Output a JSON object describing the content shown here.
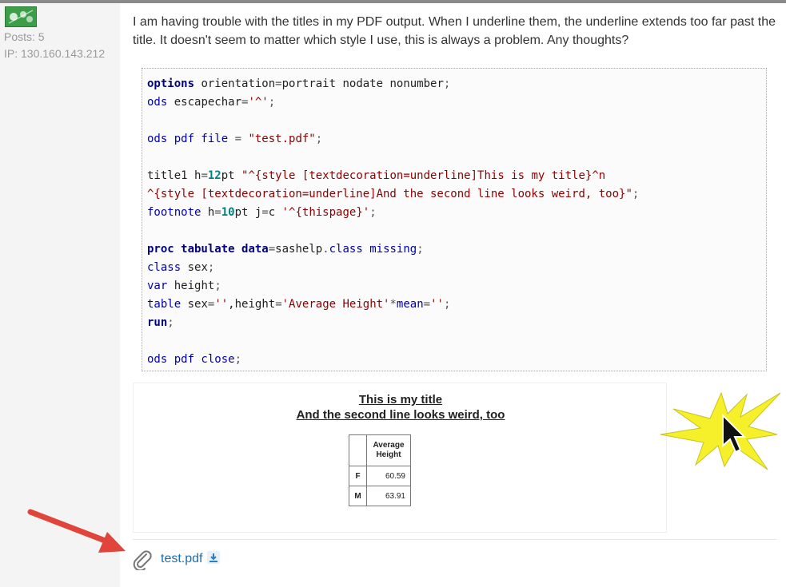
{
  "user": {
    "posts": "Posts: 5",
    "ip": "IP: 130.160.143.212"
  },
  "post": {
    "line1": "I am having trouble with the titles in my PDF output. When I underline them, the underline extends too far past the",
    "line2": "title. It doesn't seem to matter which style I use, this is always a problem. Any thoughts?"
  },
  "code": {
    "l1": [
      "options",
      " orientation",
      "=",
      "portrait nodate nonumber",
      ";"
    ],
    "l2": [
      "ods",
      " escapechar",
      "=",
      "'^'",
      ";"
    ],
    "l3": [
      "ods pdf file",
      " = ",
      "\"test.pdf\"",
      ";"
    ],
    "l4": [
      "title1 h",
      "=",
      "12",
      "pt ",
      "\"^{style [textdecoration=underline]This is my title}^n"
    ],
    "l5": [
      "^{style [textdecoration=underline]And the second line looks weird, too}\"",
      ";"
    ],
    "l6": [
      "footnote",
      " h",
      "=",
      "10",
      "pt j",
      "=",
      "c ",
      "'^{thispage}'",
      ";"
    ],
    "l7": [
      "proc tabulate",
      " ",
      "data",
      "=",
      "sashelp",
      ".",
      "class",
      " ",
      "missing",
      ";"
    ],
    "l8": [
      "class",
      " sex",
      ";"
    ],
    "l9": [
      "var",
      " height",
      ";"
    ],
    "l10": [
      "table",
      " sex",
      "=",
      "''",
      ",height",
      "=",
      "'Average Height'",
      "*",
      "mean",
      "=",
      "''",
      ";"
    ],
    "l11": [
      "run",
      ";"
    ],
    "l12": [
      "ods pdf close",
      ";"
    ]
  },
  "screenshot": {
    "title1": "This is my title",
    "title2": "And the second line looks weird, too",
    "header": "Average Height",
    "rows": [
      {
        "label": "F",
        "value": "60.59"
      },
      {
        "label": "M",
        "value": "63.91"
      }
    ]
  },
  "attachment": {
    "name": "test.pdf"
  },
  "colors": {
    "link": "#1a6fb0",
    "arrow": "#e0443a",
    "starburst": "#f5f02a"
  }
}
